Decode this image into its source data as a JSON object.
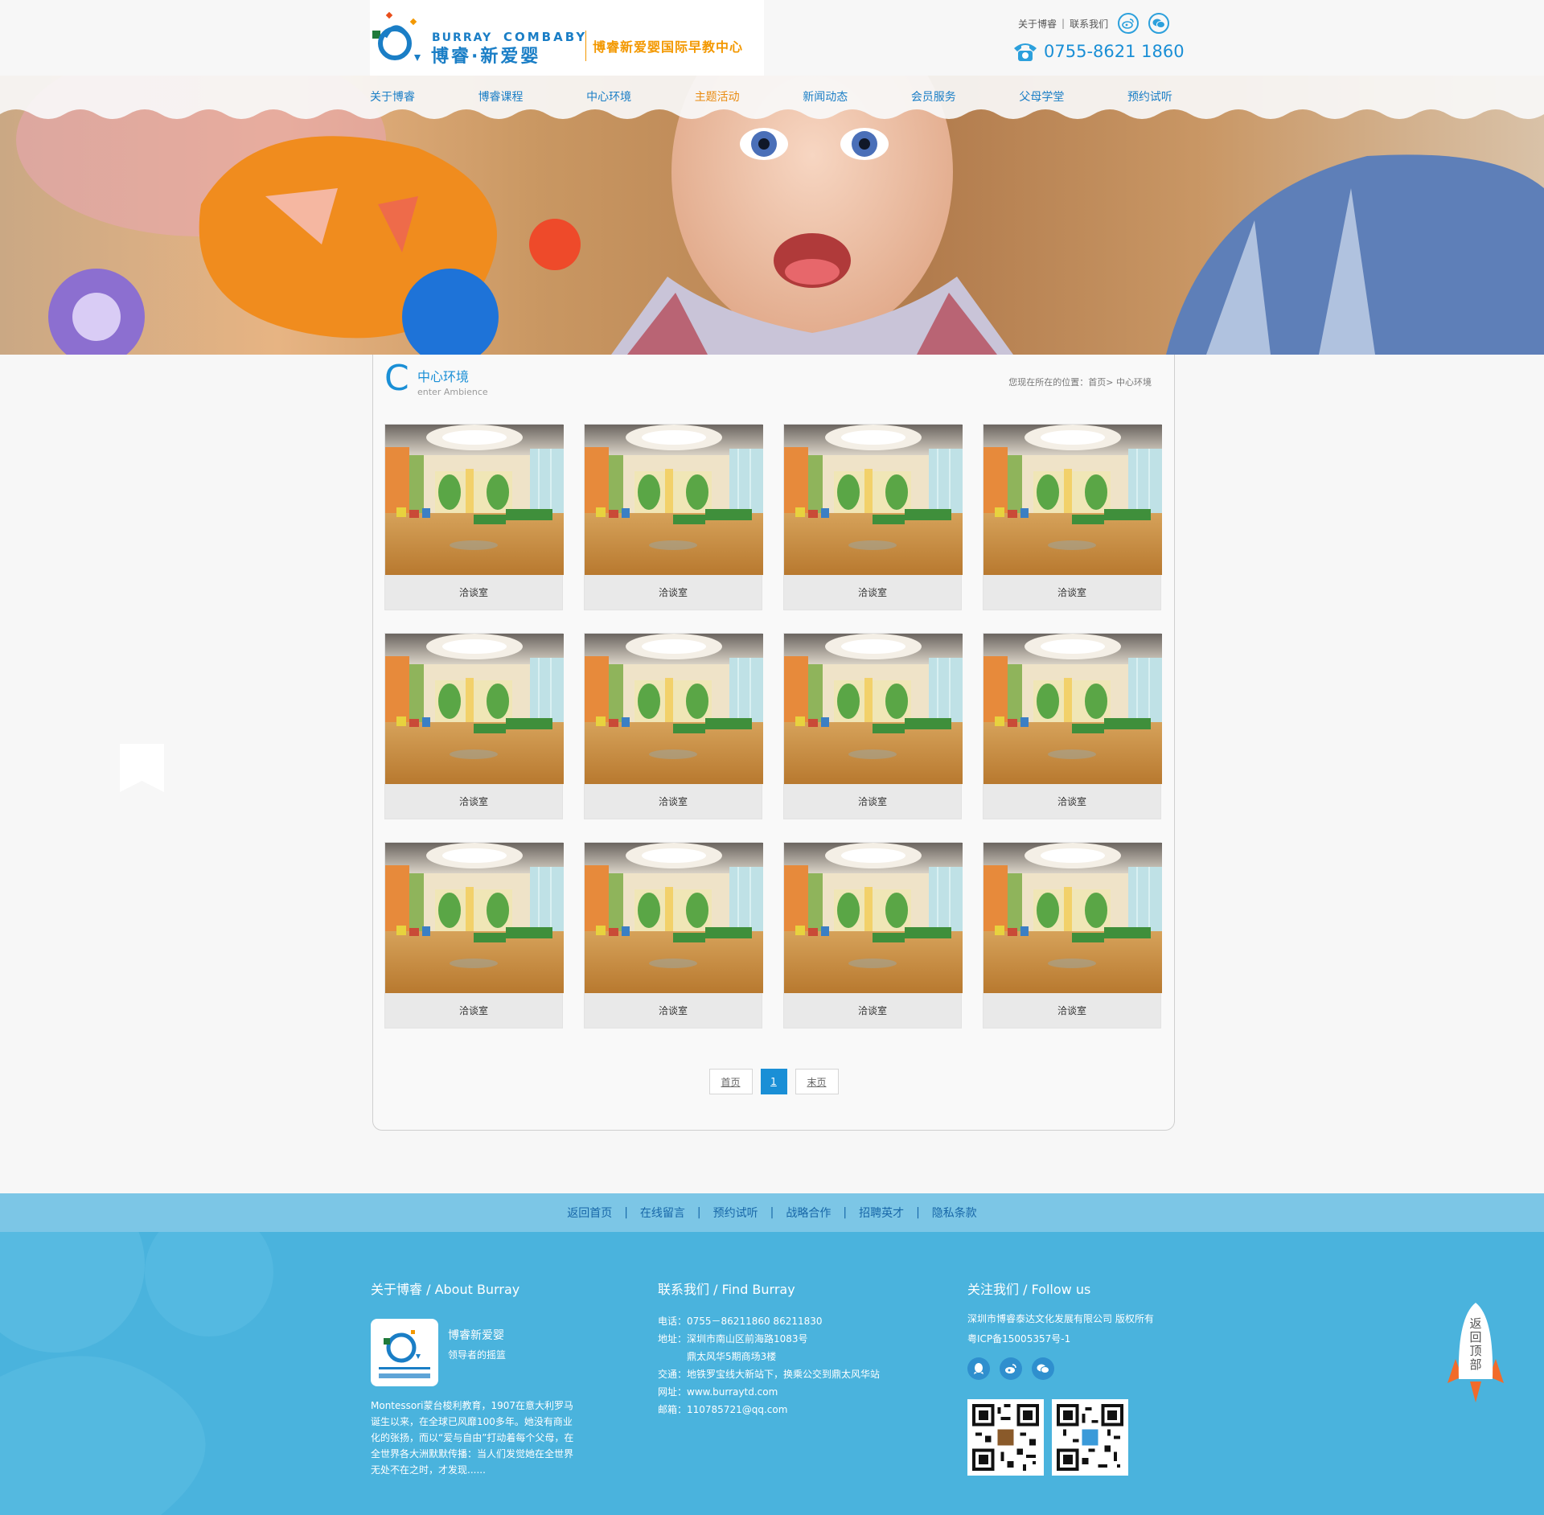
{
  "header": {
    "logo": {
      "en_left": "BURRAY",
      "en_right": "COMBABY",
      "cn": "博睿·新爱婴",
      "slogan": "博睿新爱婴国际早教中心"
    },
    "top_links": [
      {
        "label": "关于博睿"
      },
      {
        "label": "联系我们"
      }
    ],
    "top_separator": "|",
    "social_icons": [
      "weibo-icon",
      "wechat-icon"
    ],
    "phone_icon": "phone-icon",
    "phone": "0755-8621 1860"
  },
  "nav": {
    "items": [
      {
        "label": "关于博睿",
        "active": false
      },
      {
        "label": "博睿课程",
        "active": false
      },
      {
        "label": "中心环境",
        "active": false
      },
      {
        "label": "主题活动",
        "active": true
      },
      {
        "label": "新闻动态",
        "active": false
      },
      {
        "label": "会员服务",
        "active": false
      },
      {
        "label": "父母学堂",
        "active": false
      },
      {
        "label": "预约试听",
        "active": false
      }
    ]
  },
  "section": {
    "title_initial": "C",
    "title": "中心环境",
    "subtitle": "enter Ambience",
    "breadcrumb": "您现在所在的位置：首页>  中心环境"
  },
  "gallery": {
    "items": [
      {
        "label": "洽谈室"
      },
      {
        "label": "洽谈室"
      },
      {
        "label": "洽谈室"
      },
      {
        "label": "洽谈室"
      },
      {
        "label": "洽谈室"
      },
      {
        "label": "洽谈室"
      },
      {
        "label": "洽谈室"
      },
      {
        "label": "洽谈室"
      },
      {
        "label": "洽谈室"
      },
      {
        "label": "洽谈室"
      },
      {
        "label": "洽谈室"
      },
      {
        "label": "洽谈室"
      }
    ]
  },
  "pagination": {
    "first": "首页",
    "current": "1",
    "last": "末页"
  },
  "footer_bar": {
    "links": [
      {
        "label": "返回首页"
      },
      {
        "label": "在线留言"
      },
      {
        "label": "预约试听"
      },
      {
        "label": "战略合作"
      },
      {
        "label": "招聘英才"
      },
      {
        "label": "隐私条款"
      }
    ],
    "separator": "|"
  },
  "footer": {
    "about": {
      "heading": "关于博睿 / About Burray",
      "brand": "博睿新爱婴",
      "tagline": "领导者的摇篮",
      "description": "Montessori蒙台梭利教育，1907在意大利罗马诞生以来，在全球已风靡100多年。她没有商业化的张扬，而以“爱与自由”打动着每个父母，在全世界各大洲默默传播：当人们发觉她在全世界无处不在之时，才发现......"
    },
    "contact": {
      "heading": "联系我们 / Find Burray",
      "phone": "电话：0755－86211860  86211830",
      "address": "地址：深圳市南山区前海路1083号",
      "address2": "鼎太风华5期商场3楼",
      "traffic": "交通：地铁罗宝线大新站下，换乘公交到鼎太风华站",
      "website": "网址：www.burraytd.com",
      "email": "邮箱：110785721@qq.com"
    },
    "follow": {
      "heading": "关注我们 / Follow us",
      "company": "深圳市博睿泰达文化发展有限公司 版权所有",
      "icp": "粤ICP备15005357号-1",
      "social_icons": [
        "qq-icon",
        "weibo-icon",
        "wechat-icon"
      ]
    },
    "back_to_top": [
      "返",
      "回",
      "顶",
      "部"
    ]
  },
  "colors": {
    "brand_blue": "#1a8fd6",
    "accent_orange": "#f39800",
    "footer_bar": "#7cc6e6",
    "footer": "#4ab3dd"
  }
}
